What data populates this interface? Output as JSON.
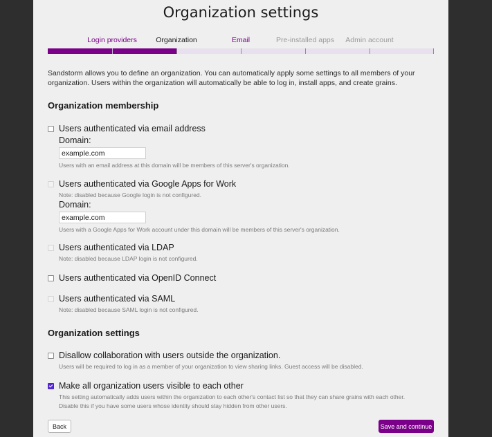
{
  "page": {
    "title": "Organization settings",
    "intro": "Sandstorm allows you to define an organization. You can automatically apply some settings to all members of your organization. Users within the organization will automatically be able to log in, install apps, and create grains."
  },
  "steps": [
    {
      "label": "Login providers",
      "state": "done"
    },
    {
      "label": "Organization",
      "state": "current"
    },
    {
      "label": "Email",
      "state": "next"
    },
    {
      "label": "Pre-installed apps",
      "state": "future"
    },
    {
      "label": "Admin account",
      "state": "future"
    }
  ],
  "progress": {
    "completed_segments": 2,
    "total_segments": 5
  },
  "membership": {
    "heading": "Organization membership",
    "email": {
      "label": "Users authenticated via email address",
      "checked": false,
      "disabled": false,
      "domain_label": "Domain:",
      "domain_value": "example.com",
      "help": "Users with an email address at this domain will be members of this server's organization."
    },
    "google": {
      "label": "Users authenticated via Google Apps for Work",
      "checked": false,
      "disabled": true,
      "note": "Note: disabled because Google login is not configured.",
      "domain_label": "Domain:",
      "domain_value": "example.com",
      "help": "Users with a Google Apps for Work account under this domain will be members of this server's organization."
    },
    "ldap": {
      "label": "Users authenticated via LDAP",
      "checked": false,
      "disabled": true,
      "note": "Note: disabled because LDAP login is not configured."
    },
    "oidc": {
      "label": "Users authenticated via OpenID Connect",
      "checked": false,
      "disabled": false
    },
    "saml": {
      "label": "Users authenticated via SAML",
      "checked": false,
      "disabled": true,
      "note": "Note: disabled because SAML login is not configured."
    }
  },
  "settings": {
    "heading": "Organization settings",
    "disallow": {
      "label": "Disallow collaboration with users outside the organization.",
      "checked": false,
      "help": "Users will be required to log in as a member of your organization to view sharing links. Guest access will be disabled."
    },
    "visible": {
      "label": "Make all organization users visible to each other",
      "checked": true,
      "help_line1": "This setting automatically adds users within the organization to each other's contact list so that they can share grains with each other.",
      "help_line2": "Disable this if you have some users whose identity should stay hidden from other users."
    }
  },
  "buttons": {
    "back": "Back",
    "save": "Save and continue"
  },
  "colors": {
    "accent": "#7a0089",
    "background": "#2e2e2e",
    "panel": "#efefef",
    "progress_empty": "#e8e0ee"
  }
}
